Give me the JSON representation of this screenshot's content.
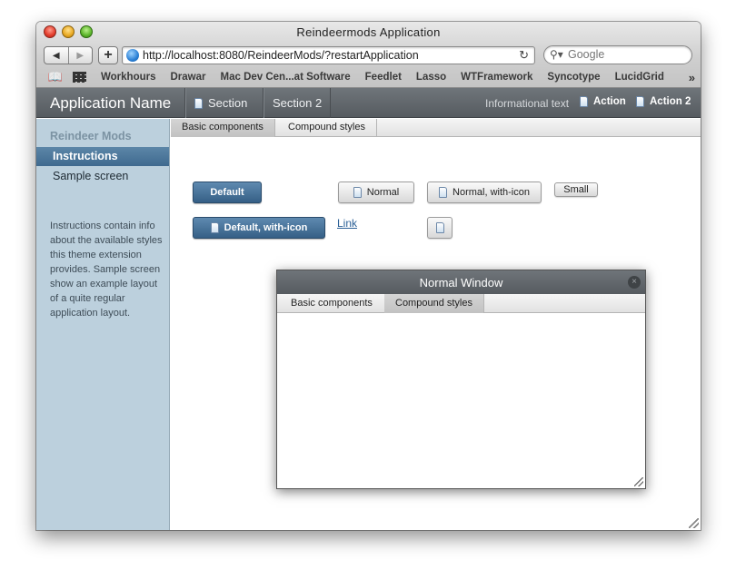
{
  "browser": {
    "window_title": "Reindeermods Application",
    "url": "http://localhost:8080/ReindeerMods/?restartApplication",
    "search_placeholder": "Google",
    "bookmarks": [
      "Workhours",
      "Drawar",
      "Mac Dev Cen...at Software",
      "Feedlet",
      "Lasso",
      "WTFramework",
      "Syncotype",
      "LucidGrid"
    ],
    "more_label": "»",
    "back_label": "◀",
    "forward_label": "▶",
    "add_label": "+",
    "reload_label": "↻"
  },
  "header": {
    "app_name": "Application Name",
    "tabs": [
      {
        "label": "Section",
        "icon": "document-icon"
      },
      {
        "label": "Section 2"
      }
    ],
    "info_text": "Informational text",
    "actions": [
      {
        "label": "Action",
        "icon": "document-icon"
      },
      {
        "label": "Action 2",
        "icon": "document-icon"
      }
    ]
  },
  "sidebar": {
    "title": "Reindeer Mods",
    "items": [
      {
        "label": "Instructions",
        "selected": true
      },
      {
        "label": "Sample screen",
        "selected": false
      }
    ],
    "description": "Instructions contain info about the available styles this theme extension provides. Sample screen show an example layout of a quite regular application layout."
  },
  "main": {
    "tabs": [
      {
        "label": "Basic components",
        "active": true
      },
      {
        "label": "Compound styles",
        "active": false
      }
    ],
    "buttons": {
      "default": "Default",
      "default_icon": "Default, with-icon",
      "normal": "Normal",
      "normal_icon": "Normal, with-icon",
      "small": "Small",
      "link": "Link"
    }
  },
  "subwindow": {
    "title": "Normal Window",
    "close_label": "×",
    "tabs": [
      {
        "label": "Basic components",
        "active": false
      },
      {
        "label": "Compound styles",
        "active": true
      }
    ]
  },
  "colors": {
    "header_bg": "#5f6469",
    "sidebar_bg": "#bcd0dd",
    "selected_item": "#4a7599",
    "default_button": "#3f6a8f",
    "link": "#2a5f96"
  }
}
